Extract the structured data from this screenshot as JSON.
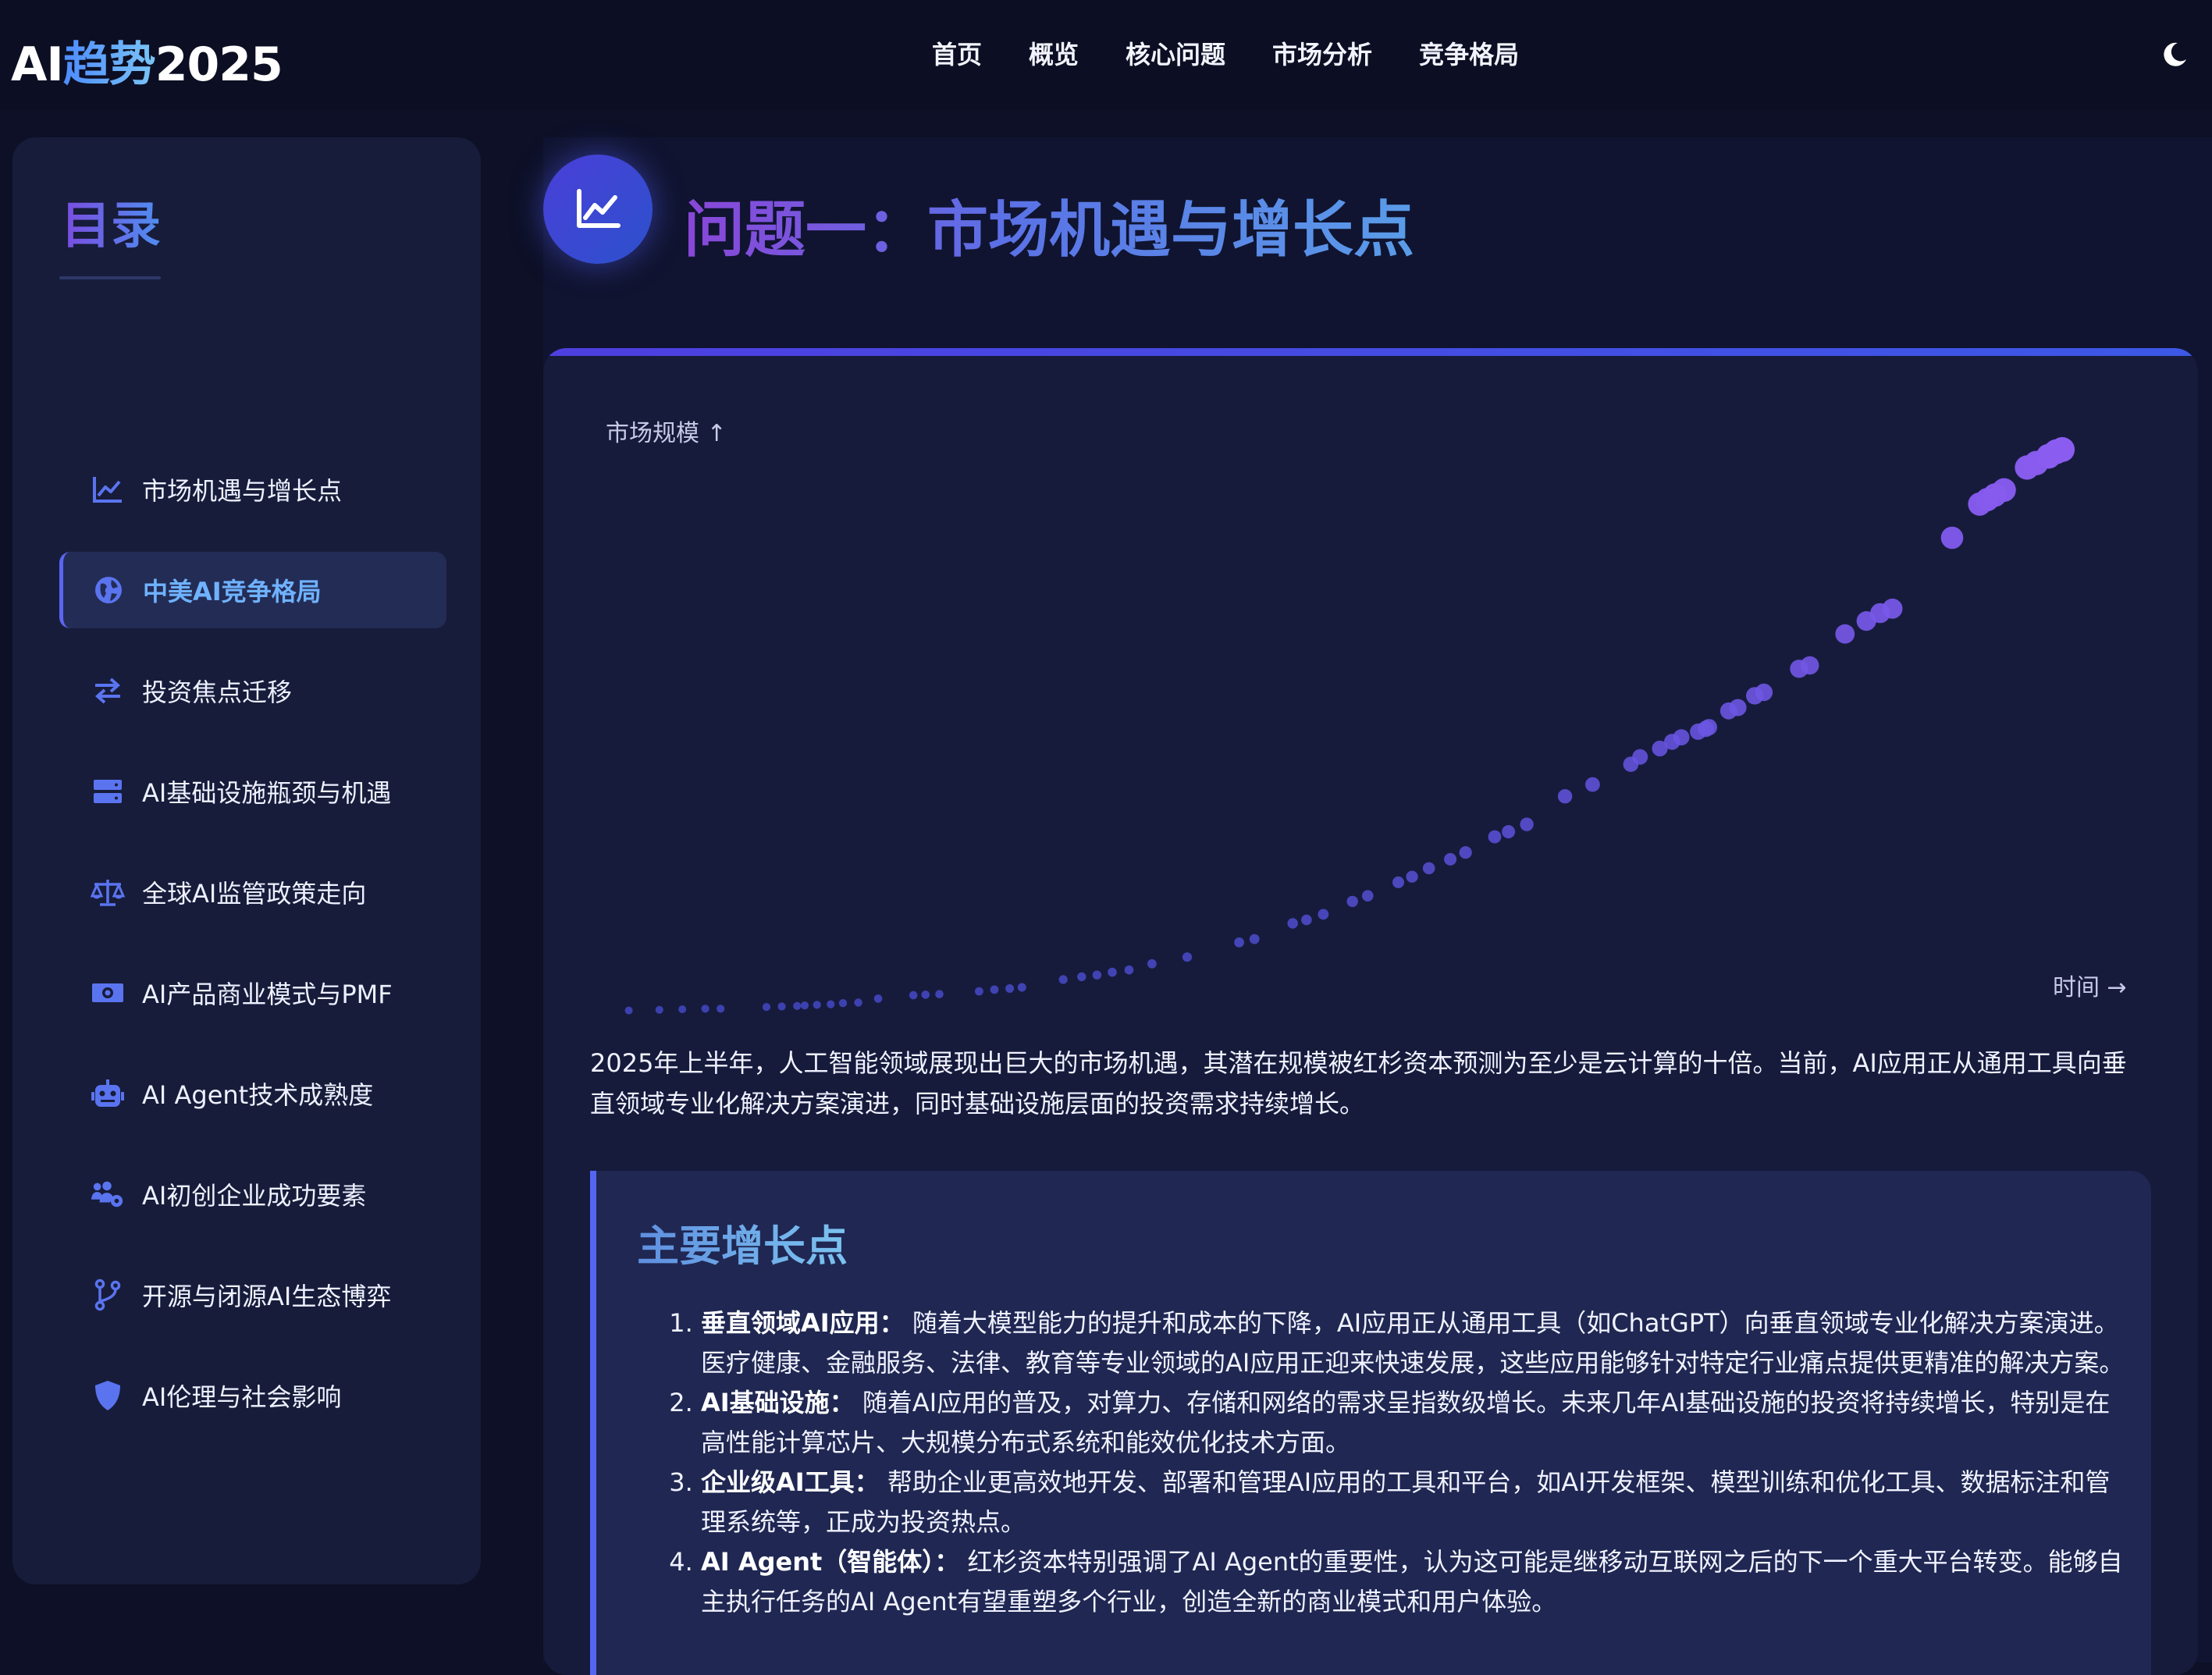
{
  "header": {
    "logo_prefix": "AI",
    "logo_accent": "趋势",
    "logo_suffix": "2025",
    "nav": [
      "首页",
      "概览",
      "核心问题",
      "市场分析",
      "竞争格局"
    ],
    "theme_icon": "moon-icon"
  },
  "sidebar": {
    "title": "目录",
    "items": [
      {
        "label": "市场机遇与增长点",
        "icon": "chart-line-icon",
        "active": false
      },
      {
        "label": "中美AI竞争格局",
        "icon": "globe-icon",
        "active": true
      },
      {
        "label": "投资焦点迁移",
        "icon": "exchange-arrows-icon",
        "active": false
      },
      {
        "label": "AI基础设施瓶颈与机遇",
        "icon": "server-icon",
        "active": false
      },
      {
        "label": "全球AI监管政策走向",
        "icon": "balance-scale-icon",
        "active": false
      },
      {
        "label": "AI产品商业模式与PMF",
        "icon": "money-bill-icon",
        "active": false
      },
      {
        "label": "AI Agent技术成熟度",
        "icon": "robot-icon",
        "active": false
      },
      {
        "label": "AI初创企业成功要素",
        "icon": "users-gear-icon",
        "active": false
      },
      {
        "label": "开源与闭源AI生态博弈",
        "icon": "code-branch-icon",
        "active": false
      },
      {
        "label": "AI伦理与社会影响",
        "icon": "shield-icon",
        "active": false
      }
    ]
  },
  "main": {
    "title": "问题一：市场机遇与增长点",
    "intro": "2025年上半年，人工智能领域展现出巨大的市场机遇，其潜在规模被红杉资本预测为至少是云计算的十倍。当前，AI应用正从通用工具向垂直领域专业化解决方案演进，同时基础设施层面的投资需求持续增长。",
    "growth_title": "主要增长点",
    "growth_items": [
      {
        "heading": "垂直领域AI应用：",
        "text": "随着大模型能力的提升和成本的下降，AI应用正从通用工具（如ChatGPT）向垂直领域专业化解决方案演进。医疗健康、金融服务、法律、教育等专业领域的AI应用正迎来快速发展，这些应用能够针对特定行业痛点提供更精准的解决方案。"
      },
      {
        "heading": "AI基础设施：",
        "text": "随着AI应用的普及，对算力、存储和网络的需求呈指数级增长。未来几年AI基础设施的投资将持续增长，特别是在高性能计算芯片、大规模分布式系统和能效优化技术方面。"
      },
      {
        "heading": "企业级AI工具：",
        "text": "帮助企业更高效地开发、部署和管理AI应用的工具和平台，如AI开发框架、模型训练和优化工具、数据标注和管理系统等，正成为投资热点。"
      },
      {
        "heading": "AI Agent（智能体）：",
        "text": "红杉资本特别强调了AI Agent的重要性，认为这可能是继移动互联网之后的下一个重大平台转变。能够自主执行任务的AI Agent有望重塑多个行业，创造全新的商业模式和用户体验。"
      }
    ]
  },
  "chart_data": {
    "type": "scatter",
    "ylabel": "市场规模 ↑",
    "xlabel": "时间 →",
    "xlim": [
      0,
      100
    ],
    "ylim": [
      0,
      100
    ],
    "grid": false,
    "colors": {
      "low": "#4a4fd6",
      "high": "#8b5cf0"
    },
    "points": [
      [
        1,
        0.2
      ],
      [
        3,
        0.3
      ],
      [
        4.5,
        0.4
      ],
      [
        6,
        0.5
      ],
      [
        7,
        0.5
      ],
      [
        10,
        0.8
      ],
      [
        11,
        0.9
      ],
      [
        12,
        1
      ],
      [
        12.5,
        1.1
      ],
      [
        13.3,
        1.2
      ],
      [
        14.2,
        1.3
      ],
      [
        15,
        1.5
      ],
      [
        16,
        1.6
      ],
      [
        17.3,
        2.3
      ],
      [
        19.6,
        2.9
      ],
      [
        20.4,
        3
      ],
      [
        21.3,
        3.1
      ],
      [
        23.9,
        3.6
      ],
      [
        24.9,
        3.9
      ],
      [
        25.9,
        4.1
      ],
      [
        26.7,
        4.3
      ],
      [
        29.4,
        5.7
      ],
      [
        30.6,
        6.2
      ],
      [
        31.6,
        6.5
      ],
      [
        32.6,
        7
      ],
      [
        33.7,
        7.4
      ],
      [
        35.2,
        8.5
      ],
      [
        37.5,
        9.7
      ],
      [
        40.9,
        12.3
      ],
      [
        41.9,
        12.9
      ],
      [
        44.4,
        15.7
      ],
      [
        45.3,
        16.3
      ],
      [
        46.4,
        17.3
      ],
      [
        48.3,
        19.6
      ],
      [
        49.3,
        20.6
      ],
      [
        51.3,
        23
      ],
      [
        52.2,
        24
      ],
      [
        53.3,
        25.5
      ],
      [
        54.7,
        27.1
      ],
      [
        55.7,
        28.3
      ],
      [
        57.6,
        31.1
      ],
      [
        58.5,
        32
      ],
      [
        59.7,
        33.3
      ],
      [
        62.2,
        38.3
      ],
      [
        64,
        40.4
      ],
      [
        66.5,
        44
      ],
      [
        67.1,
        45.3
      ],
      [
        68.4,
        46.8
      ],
      [
        69.2,
        48
      ],
      [
        69.8,
        48.8
      ],
      [
        70.9,
        49.8
      ],
      [
        71.4,
        50.3
      ],
      [
        71.6,
        50.6
      ],
      [
        72.9,
        53.5
      ],
      [
        73.5,
        54.1
      ],
      [
        74.6,
        56.2
      ],
      [
        75.2,
        56.8
      ],
      [
        77.5,
        61
      ],
      [
        78.2,
        61.6
      ],
      [
        80.5,
        67.2
      ],
      [
        81.9,
        69.5
      ],
      [
        82.8,
        70.9
      ],
      [
        83.6,
        71.7
      ],
      [
        87.5,
        84.3
      ],
      [
        89.3,
        90.3
      ],
      [
        89.8,
        91.1
      ],
      [
        90.3,
        91.9
      ],
      [
        90.9,
        92.8
      ],
      [
        92.4,
        96.8
      ],
      [
        93,
        97.6
      ],
      [
        93.8,
        98.8
      ],
      [
        94.3,
        99.6
      ],
      [
        94.7,
        100
      ]
    ]
  }
}
